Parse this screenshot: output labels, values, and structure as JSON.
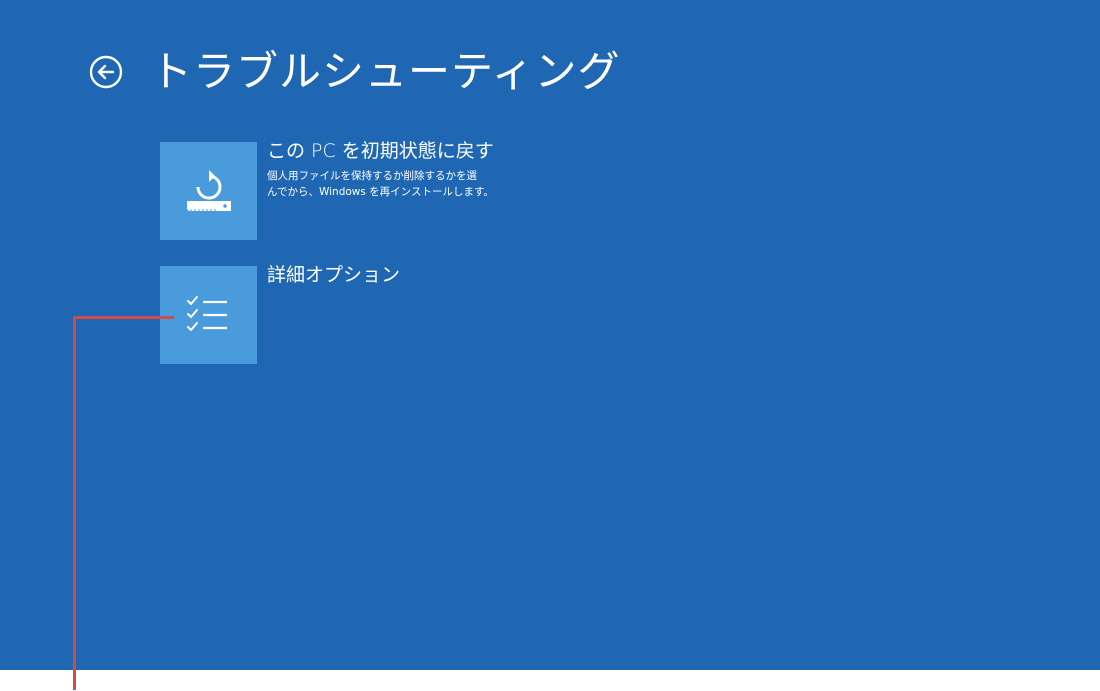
{
  "header": {
    "back_icon": "back-arrow-circle-icon",
    "title": "トラブルシューティング"
  },
  "options": [
    {
      "title": "この PC を初期状態に戻す",
      "description": "個人用ファイルを保持するか削除するかを選\nんでから、Windows を再インストールします。",
      "icon": "reset-pc-icon"
    },
    {
      "title": "詳細オプション",
      "icon": "checklist-icon"
    }
  ],
  "colors": {
    "background": "#1f67b3",
    "tile": "#4a9bdc",
    "callout": "#d14b4b"
  }
}
